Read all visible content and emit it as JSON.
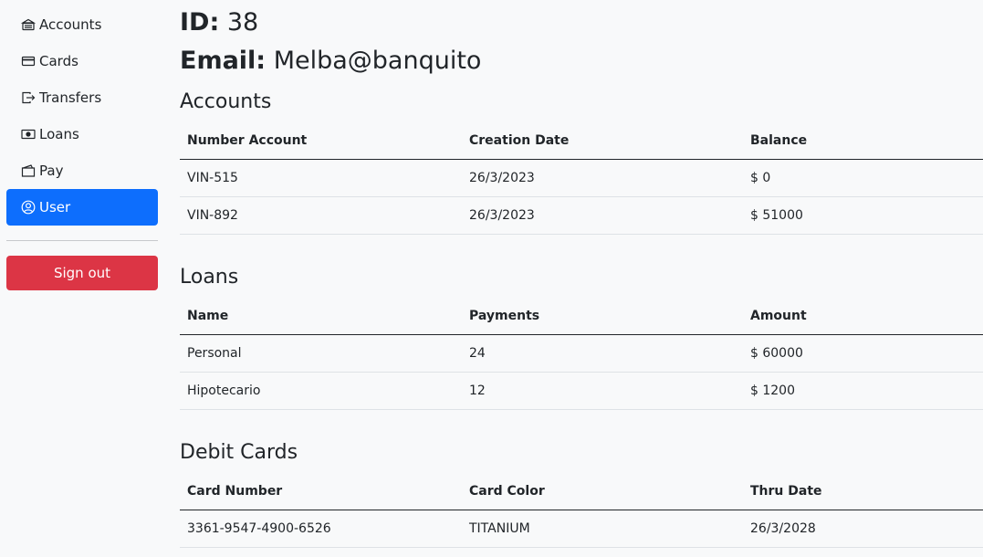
{
  "sidebar": {
    "items": [
      {
        "label": "Accounts",
        "icon": "bank-icon",
        "active": false
      },
      {
        "label": "Cards",
        "icon": "credit-card-icon",
        "active": false
      },
      {
        "label": "Transfers",
        "icon": "transfer-icon",
        "active": false
      },
      {
        "label": "Loans",
        "icon": "cash-icon",
        "active": false
      },
      {
        "label": "Pay",
        "icon": "wallet-icon",
        "active": false
      },
      {
        "label": "User",
        "icon": "user-circle-icon",
        "active": true
      }
    ],
    "signout_label": "Sign out"
  },
  "header": {
    "id_label": "ID:",
    "id_value": "38",
    "email_label": "Email:",
    "email_value": "Melba@banquito"
  },
  "accounts": {
    "title": "Accounts",
    "columns": [
      "Number Account",
      "Creation Date",
      "Balance"
    ],
    "rows": [
      [
        "VIN-515",
        "26/3/2023",
        "$ 0"
      ],
      [
        "VIN-892",
        "26/3/2023",
        "$ 51000"
      ]
    ]
  },
  "loans": {
    "title": "Loans",
    "columns": [
      "Name",
      "Payments",
      "Amount"
    ],
    "rows": [
      [
        "Personal",
        "24",
        "$ 60000"
      ],
      [
        "Hipotecario",
        "12",
        "$ 1200"
      ]
    ]
  },
  "cards": {
    "title": "Debit Cards",
    "columns": [
      "Card Number",
      "Card Color",
      "Thru Date"
    ],
    "rows": [
      [
        "3361-9547-4900-6526",
        "TITANIUM",
        "26/3/2028"
      ]
    ]
  },
  "colors": {
    "active_nav": "#0d6efd",
    "signout": "#dc3545",
    "background": "#f8f9fa"
  }
}
